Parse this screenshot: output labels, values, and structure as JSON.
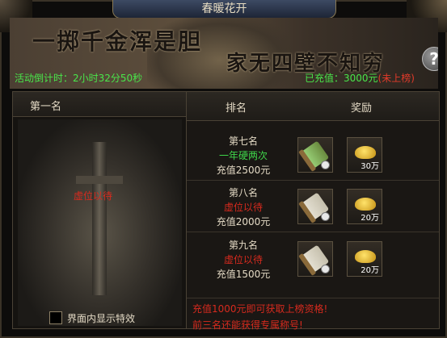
{
  "window": {
    "title": "春暖花开"
  },
  "banner": {
    "slogan_line1": "一掷千金浑是胆",
    "slogan_line2": "家无四壁不知穷",
    "countdown": "活动倒计时：2小时32分50秒",
    "recharged_label": "已充值：3000元",
    "recharged_status": "(未上榜)",
    "help_glyph": "?"
  },
  "left_panel": {
    "title": "第一名",
    "placeholder": "虚位以待",
    "checkbox_label": "界面内显示特效",
    "checkbox_checked": false
  },
  "right_panel": {
    "header_rank": "排名",
    "header_reward": "奖励",
    "rows": [
      {
        "name": "第七名",
        "holder": "一年硬两次",
        "holder_color": "#3fd64a",
        "requirement": "充值2500元",
        "reward_item_icon": "green-scroll-icon",
        "reward_gold_icon": "gold-ingot-icon",
        "reward_gold_qty": "30万"
      },
      {
        "name": "第八名",
        "holder": "虚位以待",
        "holder_color": "#d62a1e",
        "requirement": "充值2000元",
        "reward_item_icon": "white-scroll-icon",
        "reward_gold_icon": "gold-ingot-icon",
        "reward_gold_qty": "20万"
      },
      {
        "name": "第九名",
        "holder": "虚位以待",
        "holder_color": "#d62a1e",
        "requirement": "充值1500元",
        "reward_item_icon": "white-scroll-icon",
        "reward_gold_icon": "gold-ingot-icon",
        "reward_gold_qty": "20万"
      }
    ]
  },
  "tips": {
    "line1": "充值1000元即可获取上榜资格!",
    "line2": "前三名还能获得专属称号!"
  }
}
